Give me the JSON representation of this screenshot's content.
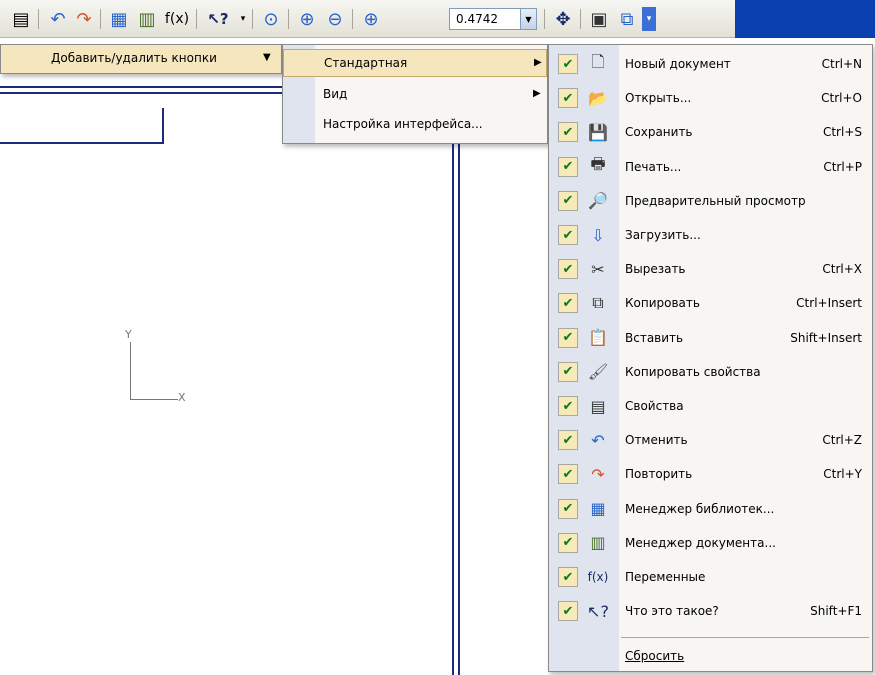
{
  "toolbar": {
    "zoom_value": "0.4742",
    "buttons": [
      {
        "name": "properties-icon",
        "glyph": "▤"
      },
      {
        "name": "undo-icon",
        "glyph": "↶"
      },
      {
        "name": "redo-icon",
        "glyph": "↷"
      },
      {
        "name": "library-manager-icon",
        "glyph": "▦"
      },
      {
        "name": "document-manager-icon",
        "glyph": "▥"
      },
      {
        "name": "variables-icon",
        "glyph": "f(x)"
      },
      {
        "name": "whats-this-icon",
        "glyph": "↖?"
      },
      {
        "name": "zoom-window-icon",
        "glyph": "🔍"
      },
      {
        "name": "zoom-in-icon",
        "glyph": "⊕"
      },
      {
        "name": "zoom-out-icon",
        "glyph": "⊖"
      },
      {
        "name": "zoom-scale-icon",
        "glyph": "⊕"
      },
      {
        "name": "pan-icon",
        "glyph": "✥"
      },
      {
        "name": "show-all-icon",
        "glyph": "▣"
      },
      {
        "name": "refresh-icon",
        "glyph": "⧉"
      }
    ]
  },
  "menu_l1": {
    "item": {
      "label": "Добавить/удалить кнопки"
    }
  },
  "menu_l2": {
    "items": [
      {
        "label": "Стандартная",
        "has_submenu": true,
        "selected": true
      },
      {
        "label": "Вид",
        "has_submenu": true,
        "selected": false
      },
      {
        "label": "Настройка интерфейса...",
        "has_submenu": false,
        "selected": false
      }
    ]
  },
  "menu_l3": {
    "items": [
      {
        "icon": "new-document-icon",
        "glyph": "🗋",
        "label": "Новый документ",
        "shortcut": "Ctrl+N"
      },
      {
        "icon": "open-folder-icon",
        "glyph": "📂",
        "label": "Открыть...",
        "shortcut": "Ctrl+O"
      },
      {
        "icon": "save-icon",
        "glyph": "💾",
        "label": "Сохранить",
        "shortcut": "Ctrl+S"
      },
      {
        "icon": "print-icon",
        "glyph": "🖶",
        "label": "Печать...",
        "shortcut": "Ctrl+P"
      },
      {
        "icon": "print-preview-icon",
        "glyph": "🔎",
        "label": "Предварительный просмотр",
        "shortcut": ""
      },
      {
        "icon": "load-icon",
        "glyph": "⇩",
        "label": "Загрузить...",
        "shortcut": ""
      },
      {
        "icon": "cut-icon",
        "glyph": "✂",
        "label": "Вырезать",
        "shortcut": "Ctrl+X"
      },
      {
        "icon": "copy-icon",
        "glyph": "⧉",
        "label": "Копировать",
        "shortcut": "Ctrl+Insert"
      },
      {
        "icon": "paste-icon",
        "glyph": "📋",
        "label": "Вставить",
        "shortcut": "Shift+Insert"
      },
      {
        "icon": "copy-properties-icon",
        "glyph": "🖌",
        "label": "Копировать свойства",
        "shortcut": ""
      },
      {
        "icon": "properties-icon",
        "glyph": "▤",
        "label": "Свойства",
        "shortcut": ""
      },
      {
        "icon": "undo-icon",
        "glyph": "↶",
        "label": "Отменить",
        "shortcut": "Ctrl+Z"
      },
      {
        "icon": "redo-icon",
        "glyph": "↷",
        "label": "Повторить",
        "shortcut": "Ctrl+Y"
      },
      {
        "icon": "library-manager-icon",
        "glyph": "▦",
        "label": "Менеджер библиотек...",
        "shortcut": ""
      },
      {
        "icon": "document-manager-icon",
        "glyph": "▥",
        "label": "Менеджер документа...",
        "shortcut": ""
      },
      {
        "icon": "variables-icon",
        "glyph": "f(x)",
        "label": "Переменные",
        "shortcut": ""
      },
      {
        "icon": "whats-this-icon",
        "glyph": "↖?",
        "label": "Что это такое?",
        "shortcut": "Shift+F1"
      }
    ],
    "reset_label": "Сбросить"
  },
  "canvas": {
    "axis_y_label": "Y",
    "axis_x_label": "X"
  },
  "colors": {
    "menu_highlight": "#f5e6be",
    "check_green": "#0a7a18",
    "drawing_lines": "#1d2c7a",
    "title_blue": "#0a3fb0"
  }
}
